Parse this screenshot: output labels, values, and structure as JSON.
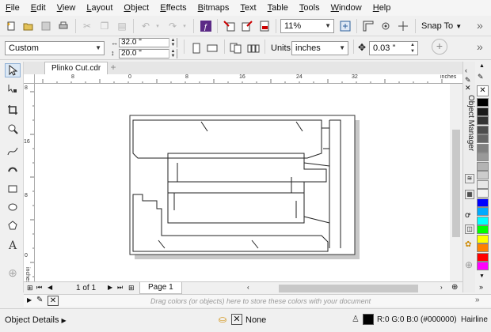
{
  "menu": [
    "File",
    "Edit",
    "View",
    "Layout",
    "Object",
    "Effects",
    "Bitmaps",
    "Text",
    "Table",
    "Tools",
    "Window",
    "Help"
  ],
  "toolbar": {
    "zoom_value": "11%",
    "snap_label": "Snap To",
    "more_label": "»"
  },
  "propbar": {
    "preset_value": "Custom",
    "width_value": "32.0 \"",
    "height_value": "20.0 \"",
    "units_label": "Units:",
    "units_value": "inches",
    "nudge_value": "0.03 \""
  },
  "tab": {
    "filename": "Plinko Cut.cdr",
    "add_label": "+"
  },
  "ruler": {
    "top_labels": [
      "8",
      "0",
      "8",
      "16",
      "24",
      "32"
    ],
    "top_unit": "inches",
    "left_labels": [
      "8",
      "16",
      "8",
      "0"
    ],
    "left_unit": "inches"
  },
  "docker": {
    "title": "Object Manager"
  },
  "pagebar": {
    "page_count": "1 of 1",
    "page_tab": "Page 1"
  },
  "colorwell": {
    "hint": "Drag colors (or objects) here to store these colors with your document"
  },
  "status": {
    "details_label": "Object Details",
    "fill_label": "None",
    "outline_color": "R:0 G:0 B:0 (#000000)",
    "outline_width": "Hairline"
  },
  "palette": {
    "colors": [
      "#ffffff",
      "#000000",
      "#1a1a1a",
      "#333333",
      "#4d4d4d",
      "#666666",
      "#808080",
      "#999999",
      "#b3b3b3",
      "#cccccc",
      "#e6e6e6",
      "#f2f2f2",
      "#0000ff",
      "#00aaff",
      "#00ffff",
      "#00ff00",
      "#ffff00",
      "#ff8000",
      "#ff0000",
      "#ff00ff"
    ]
  }
}
